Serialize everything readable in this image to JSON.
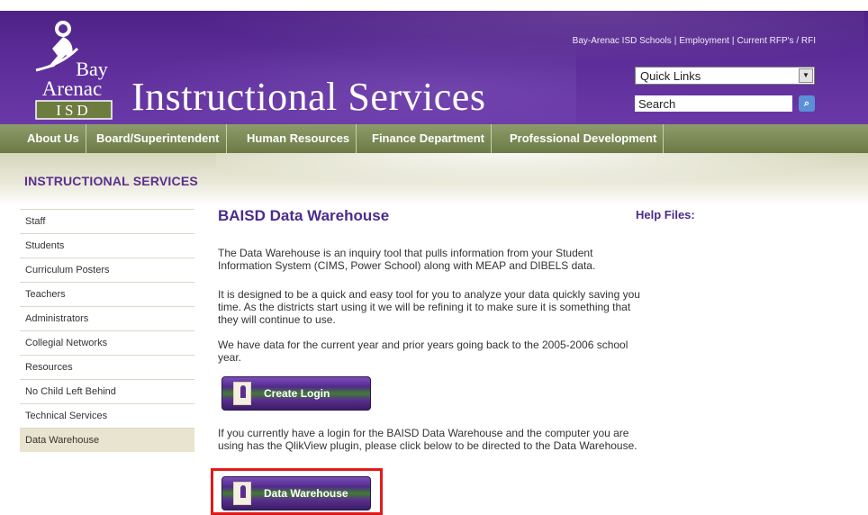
{
  "header": {
    "site_title": "Instructional Services",
    "logo": {
      "line1": "Bay",
      "line2": "Arenac",
      "line3": "ISD"
    },
    "top_links": [
      "Bay-Arenac ISD Schools",
      "Employment",
      "Current RFP's / RFI"
    ],
    "quick_links": {
      "selected": "Quick Links"
    },
    "search": {
      "value": "Search"
    }
  },
  "nav": {
    "items": [
      "About Us",
      "Board/Superintendent",
      "Human Resources",
      "Finance Department",
      "Professional Development"
    ]
  },
  "section_title": "INSTRUCTIONAL SERVICES",
  "sidebar": {
    "items": [
      {
        "label": "Staff",
        "active": false
      },
      {
        "label": "Students",
        "active": false
      },
      {
        "label": "Curriculum Posters",
        "active": false
      },
      {
        "label": "Teachers",
        "active": false
      },
      {
        "label": "Administrators",
        "active": false
      },
      {
        "label": "Collegial Networks",
        "active": false
      },
      {
        "label": "Resources",
        "active": false
      },
      {
        "label": "No Child Left Behind",
        "active": false
      },
      {
        "label": "Technical Services",
        "active": false
      },
      {
        "label": "Data Warehouse",
        "active": true
      }
    ]
  },
  "main": {
    "title": "BAISD Data Warehouse",
    "para1": "The Data Warehouse is an inquiry tool that pulls information from your Student Information System (CIMS, Power School) along with MEAP and DIBELS data.",
    "para2": "It is designed to be a quick and easy tool for you to analyze your data quickly saving you time. As the districts start using it we will be refining it to make sure it is something that they will continue to use.",
    "para3": "We have data for the current year and prior years going back to the 2005-2006 school year.",
    "create_login_label": "Create Login",
    "para4": "If you currently have a login for the BAISD Data Warehouse and the computer you are using has the QlikView plugin, please click below to be directed to the Data Warehouse.",
    "data_warehouse_label": "Data Warehouse"
  },
  "help": {
    "title": "Help Files:"
  },
  "colors": {
    "header_purple": "#5b2c96",
    "nav_olive": "#6b7a45",
    "title_purple": "#4b2c8c",
    "highlight_red": "#e01b1b"
  }
}
